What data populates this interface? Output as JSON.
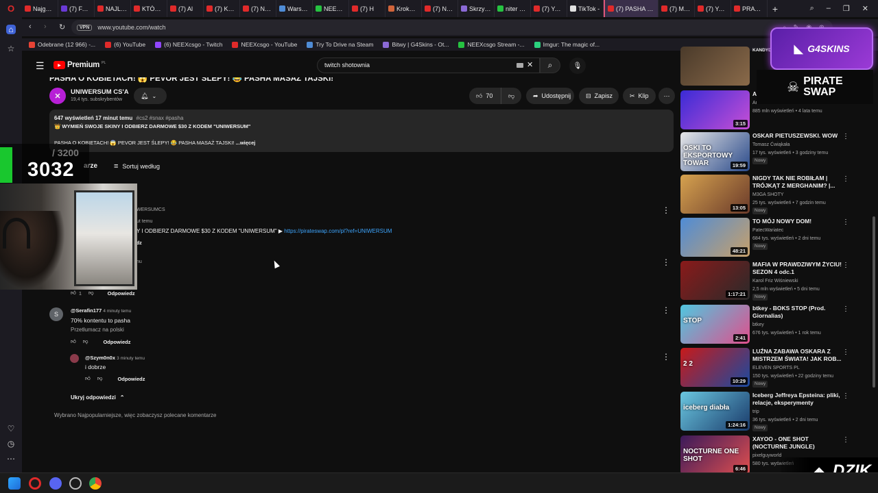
{
  "browser": {
    "tabs": [
      {
        "label": "Najgorsi",
        "color": "#e02a2a"
      },
      {
        "label": "(7) FAME",
        "color": "#6a3ad6"
      },
      {
        "label": "NAJLEPS",
        "color": "#e02a2a"
      },
      {
        "label": "KTÓRA Z",
        "color": "#e02a2a"
      },
      {
        "label": "(7) Al",
        "color": "#e02a2a"
      },
      {
        "label": "(7) KTÓR",
        "color": "#e02a2a"
      },
      {
        "label": "(7) NEEX",
        "color": "#e02a2a"
      },
      {
        "label": "Warsztat",
        "color": "#4f8cd6"
      },
      {
        "label": "NEEXcsg",
        "color": "#26c241"
      },
      {
        "label": "(7) H",
        "color": "#e02a2a"
      },
      {
        "label": "Krokody",
        "color": "#d1643a"
      },
      {
        "label": "(7) NEEX",
        "color": "#e02a2a"
      },
      {
        "label": "Skrzynki",
        "color": "#8b6ad6"
      },
      {
        "label": "niter Stre",
        "color": "#26c241"
      },
      {
        "label": "(7) YouTu",
        "color": "#e02a2a"
      },
      {
        "label": "TikTok -",
        "color": "#e0e0e0"
      },
      {
        "label": "(7) PASHA O KC",
        "color": "#e02a2a",
        "active": true
      },
      {
        "label": "(7) Mam",
        "color": "#e02a2a"
      },
      {
        "label": "(7) YouTu",
        "color": "#e02a2a"
      },
      {
        "label": "PRAWIE",
        "color": "#e02a2a"
      }
    ],
    "new_tab_icon": "plus-icon",
    "vpn_label": "VPN",
    "url": "www.youtube.com/watch",
    "bookmarks": [
      {
        "label": "Odebrane (12 966) -...",
        "color": "#e84335"
      },
      {
        "label": "(6) YouTube",
        "color": "#e02a2a"
      },
      {
        "label": "(6) NEEXcsgo - Twitch",
        "color": "#9146ff"
      },
      {
        "label": "NEEXcsgo - YouTube",
        "color": "#e02a2a"
      },
      {
        "label": "Try To Drive na Steam",
        "color": "#4f8cd6"
      },
      {
        "label": "Bitwy | G4Skins - Ot...",
        "color": "#8b6ad6"
      },
      {
        "label": "NEEXcsgo Stream -...",
        "color": "#26c241"
      },
      {
        "label": "Imgur: The magic of...",
        "color": "#2bd17e"
      }
    ]
  },
  "youtube": {
    "logo_text": "Premium",
    "logo_suffix": "PL",
    "search_value": "twitch shotownia",
    "video_title": "PASHA O KOBIETACH! 😱 PEVOR JEST ŚLEPY! 😂 PASHA MASAŻ TAJSKI!",
    "channel_name": "UNIWERSUM CS'A",
    "channel_subs": "19,4 tys. subskrybentów",
    "likes": "70",
    "share_label": "Udostępnij",
    "save_label": "Zapisz",
    "clip_label": "Klip",
    "description": {
      "stats": "647 wyświetleń  17 minut temu",
      "tags": "#cs2 #snax #pasha",
      "line1": "👑 WYMIEŃ SWOJE SKINY I ODBIERZ DARMOWE $30 Z KODEM \"UNIWERSUM\"",
      "line2": "PASHA O KOBIETACH! 😱 PEVOR JEST ŚLEPY! 😂 PASHA MASAŻ TAJSKI!",
      "more": "...więcej"
    },
    "comments": {
      "count_partial": "arze",
      "sort_label": "Sortuj według",
      "pinned_author_partial": "WERSUMCS",
      "pinned_time_partial": "ut temu",
      "pinned_text_partial": "Y I ODBIERZ DARMOWE $30 Z KODEM \"UNIWERSUM\" ▶",
      "pinned_link": "https://pirateswap.com/pl?ref=UNIWERSUM",
      "pinned_reply_partial": "dz",
      "second_time_partial": "nu",
      "second_likes": "1",
      "reply_label": "Odpowiedz",
      "reply1": {
        "avatar": "S",
        "author": "@Serafin177",
        "time": "4 minuty temu",
        "text": "70% kontentu to pasha",
        "translate": "Przetłumacz na polski"
      },
      "reply2": {
        "author": "@Szym0n0x",
        "time": "3 minuty temu",
        "text": "i dobrze"
      },
      "hide_replies": "Ukryj odpowiedzi",
      "footer_note": "Wybrano Najpopularniejsze, więc zobaczysz polecane komentarze"
    },
    "recommendations": [
      {
        "title": "KANDYDAT NA PIKĘ 31:10",
        "meta": [],
        "new": "",
        "duration": "",
        "colors": [
          "#4a3a2a",
          "#8a6a4a"
        ]
      },
      {
        "title": "Anitta",
        "meta": [
          "Anitta",
          "885 mln wyświetleń • 4 lata temu"
        ],
        "new": "",
        "duration": "3:15",
        "colors": [
          "#3a2bd6",
          "#c74fd6"
        ]
      },
      {
        "title": "OSKAR PIETUSZEWSKI. WOW",
        "meta": [
          "Tomasz Ćwiąkała",
          "17 tys. wyświetleń • 3 godziny temu"
        ],
        "new": "Nowy",
        "duration": "19:59",
        "colors": [
          "#e8e8e8",
          "#2a4a8a"
        ],
        "thumb_text": "OSKI TO EKSPORTOWY TOWAR"
      },
      {
        "title": "NIGDY TAK NIE ROBIŁAM | TRÓJKĄT Z MERGHANIM? |...",
        "meta": [
          "M3GA SHOTY",
          "25 tys. wyświetleń • 7 godzin temu"
        ],
        "new": "Nowy",
        "duration": "13:05",
        "colors": [
          "#d6a24f",
          "#6a3a2a"
        ]
      },
      {
        "title": "TO MÓJ NOWY DOM!",
        "meta": [
          "PatecWariatec",
          "684 tys. wyświetleń • 2 dni temu"
        ],
        "new": "Nowy",
        "duration": "48:21",
        "colors": [
          "#4f8cd6",
          "#c7a06a"
        ]
      },
      {
        "title": "MAFIA W PRAWDZIWYM ŻYCIU! SEZON 4 odc.1",
        "meta": [
          "Karol Friz Wiśniewski",
          "2,5 mln wyświetleń • 5 dni temu"
        ],
        "new": "Nowy",
        "duration": "1:17:21",
        "colors": [
          "#8a1a1a",
          "#2a2a2a"
        ]
      },
      {
        "title": "btkey - BOKS STOP (Prod. Giornalias)",
        "meta": [
          "btkey",
          "676 tys. wyświetleń • 1 rok temu"
        ],
        "new": "",
        "duration": "2:41",
        "colors": [
          "#4fc7e0",
          "#e04f8c"
        ],
        "thumb_text": "STOP"
      },
      {
        "title": "LUŹNA ZABAWA OSKARA Z MISTRZEM ŚWIATA! JAK ROB...",
        "meta": [
          "ELEVEN SPORTS PL",
          "150 tys. wyświetleń • 22 godziny temu"
        ],
        "new": "Nowy",
        "duration": "10:29",
        "colors": [
          "#c71a1a",
          "#1a4aa0"
        ],
        "thumb_text": "2 2"
      },
      {
        "title": "Iceberg Jeffreya Epsteina: pliki, relacje, eksperymenty",
        "meta": [
          "trip",
          "36 tys. wyświetleń • 2 dni temu"
        ],
        "new": "Nowy",
        "duration": "1:24:16",
        "colors": [
          "#6ac7e0",
          "#1a3a6a"
        ],
        "thumb_text": "iceberg diabła"
      },
      {
        "title": "XAYOO - ONE SHOT (NOCTURNE JUNGLE)",
        "meta": [
          "pixelguyworld",
          "580 tys. wyświetleń"
        ],
        "new": "",
        "duration": "6:46",
        "colors": [
          "#3a1a5a",
          "#e04f4f"
        ],
        "thumb_text": "NOCTURNE ONE SHOT"
      }
    ]
  },
  "overlays": {
    "counter_goal": "/ 3200",
    "counter_value": "3032",
    "g4skins": "G4SKINS",
    "pirate_line1": "PIRATE",
    "pirate_line2": "SWAP",
    "dzik": "DZIK"
  }
}
